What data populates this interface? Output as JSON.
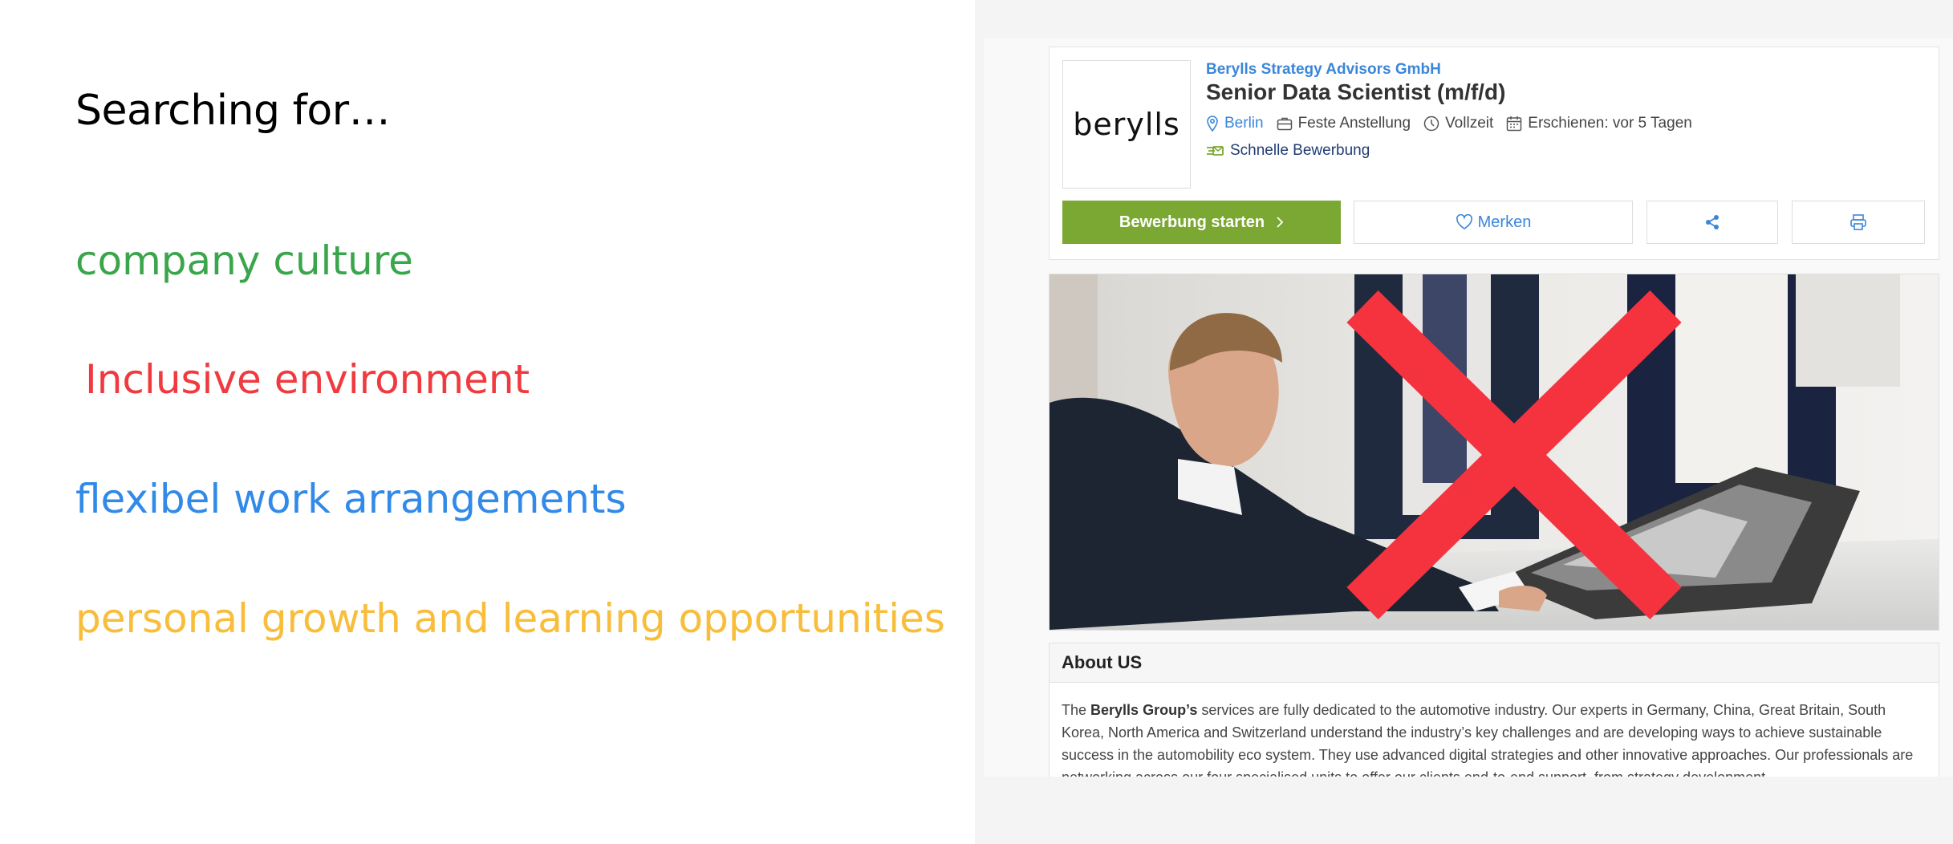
{
  "slide": {
    "heading": "Searching for…",
    "criteria": [
      {
        "text": "company culture",
        "color": "#3aa64c"
      },
      {
        "text": "Inclusive environment",
        "color": "#f03a3f"
      },
      {
        "text": "flexibel work arrangements",
        "color": "#318ae8"
      },
      {
        "text": "personal growth and learning opportunities",
        "color": "#f8bd3a"
      }
    ]
  },
  "job": {
    "logo_text": "berylls",
    "company": "Berylls Strategy Advisors GmbH",
    "title": "Senior Data Scientist (m/f/d)",
    "location": "Berlin",
    "employment_type": "Feste Anstellung",
    "hours": "Vollzeit",
    "posted": "Erschienen: vor 5 Tagen",
    "quick_apply": "Schnelle Bewerbung",
    "apply_button": "Bewerbung starten",
    "save_button": "Merken",
    "icons": {
      "location": "map-pin-icon",
      "type": "briefcase-icon",
      "hours": "clock-icon",
      "posted": "calendar-icon",
      "share": "share-icon",
      "print": "printer-icon"
    },
    "colors": {
      "accent": "#3b86d9",
      "apply": "#7aa832",
      "cross": "#f5333f"
    }
  },
  "about": {
    "heading": "About US",
    "text_before": "The ",
    "brand": "Berylls Group’s",
    "text_after": " services are fully dedicated to the automotive industry. Our experts in Germany, China, Great Britain, South Korea, North America and Switzerland understand the industry’s key challenges and are developing ways to achieve sustainable success in the automobility eco system. They use advanced digital strategies and other innovative approaches. Our professionals are networking across our four specialised units to offer our clients end-to-end support, from strategy development"
  }
}
